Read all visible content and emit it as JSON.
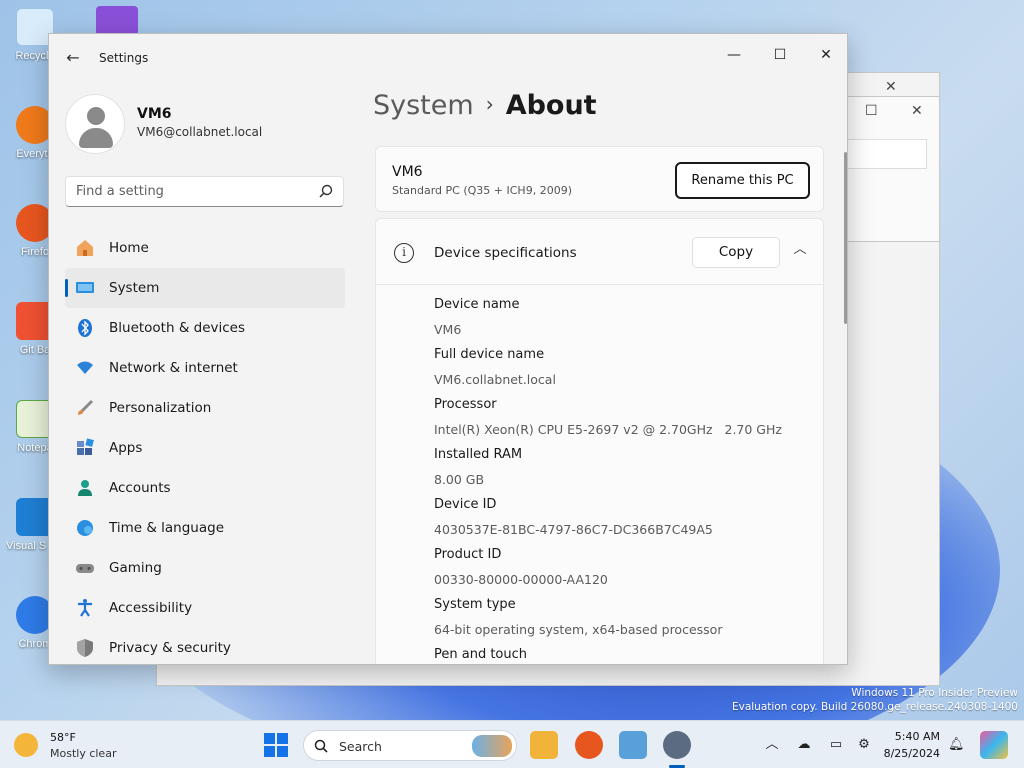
{
  "settings": {
    "app_title": "Settings",
    "profile": {
      "name": "VM6",
      "email": "VM6@collabnet.local"
    },
    "search": {
      "placeholder": "Find a setting"
    },
    "nav": [
      {
        "label": "Home",
        "icon": "home-icon"
      },
      {
        "label": "System",
        "icon": "system-icon"
      },
      {
        "label": "Bluetooth & devices",
        "icon": "bluetooth-icon"
      },
      {
        "label": "Network & internet",
        "icon": "wifi-icon"
      },
      {
        "label": "Personalization",
        "icon": "brush-icon"
      },
      {
        "label": "Apps",
        "icon": "apps-icon"
      },
      {
        "label": "Accounts",
        "icon": "accounts-icon"
      },
      {
        "label": "Time & language",
        "icon": "globe-icon"
      },
      {
        "label": "Gaming",
        "icon": "gamepad-icon"
      },
      {
        "label": "Accessibility",
        "icon": "accessibility-icon"
      },
      {
        "label": "Privacy & security",
        "icon": "shield-icon"
      }
    ],
    "active_nav": "System",
    "breadcrumb": {
      "parent": "System",
      "current": "About"
    },
    "pc": {
      "name": "VM6",
      "model": "Standard PC (Q35 + ICH9, 2009)",
      "rename_label": "Rename this PC"
    },
    "specs": {
      "title": "Device specifications",
      "copy_label": "Copy",
      "rows": [
        {
          "label": "Device name",
          "value": "VM6"
        },
        {
          "label": "Full device name",
          "value": "VM6.collabnet.local"
        },
        {
          "label": "Processor",
          "value": "Intel(R) Xeon(R) CPU E5-2697 v2 @ 2.70GHz   2.70 GHz"
        },
        {
          "label": "Installed RAM",
          "value": "8.00 GB"
        },
        {
          "label": "Device ID",
          "value": "4030537E-81BC-4797-86C7-DC366B7C49A5"
        },
        {
          "label": "Product ID",
          "value": "00330-80000-00000-AA120"
        },
        {
          "label": "System type",
          "value": "64-bit operating system, x64-based processor"
        },
        {
          "label": "Pen and touch",
          "value": ""
        }
      ]
    },
    "accent": "#005fb8"
  },
  "desktop": {
    "icons": [
      {
        "label": "Recycle",
        "color": "#7fb4e6"
      },
      {
        "label": "Everyth",
        "color": "#f07a1a"
      },
      {
        "label": "Firefo",
        "color": "#e8561f"
      },
      {
        "label": "Git Ba",
        "color": "#f05133"
      },
      {
        "label": "Notepa",
        "color": "#5aa845"
      },
      {
        "label": "Visual S Cod",
        "color": "#1f7fd4"
      },
      {
        "label": "Chrom",
        "color": "#2f7be8"
      }
    ],
    "watermark": {
      "line1": "Windows 11 Pro Insider Preview",
      "line2": "Evaluation copy. Build 26080.ge_release.240308-1400"
    }
  },
  "taskbar": {
    "weather": {
      "temp": "58°F",
      "condition": "Mostly clear"
    },
    "search_label": "Search",
    "clock": {
      "time": "5:40 AM",
      "date": "8/25/2024"
    }
  }
}
